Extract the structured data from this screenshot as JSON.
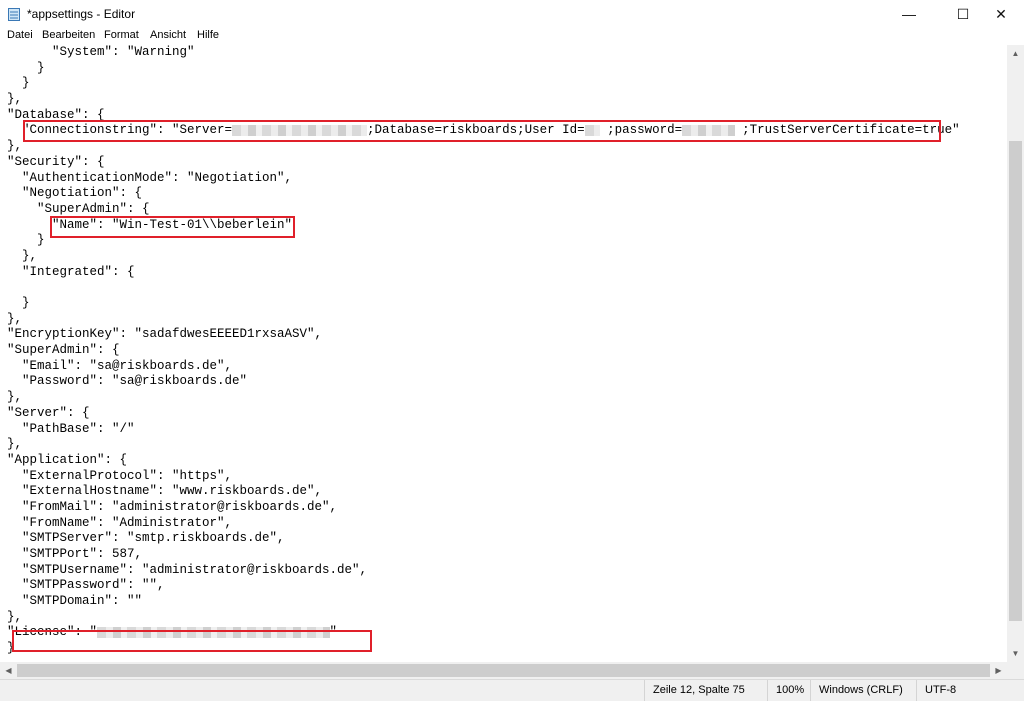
{
  "window": {
    "title": "*appsettings - Editor",
    "buttons": {
      "minimize": "—",
      "maximize": "☐",
      "close": "✕"
    }
  },
  "menu": [
    "Datei",
    "Bearbeiten",
    "Format",
    "Ansicht",
    "Hilfe"
  ],
  "code": [
    {
      "pre": "      \"System\": \"Warning\""
    },
    {
      "pre": "    }"
    },
    {
      "pre": "  }"
    },
    {
      "pre": "},"
    },
    {
      "pre": "\"Database\": {"
    },
    {
      "pre": "  \"Connectionstring\": \"Server=",
      "redacted1": 18,
      "mid": ";Database=riskboards;User Id=",
      "redacted2": 2,
      "mid2": " ;password=",
      "redacted3": 7,
      "post": " ;TrustServerCertificate=true\""
    },
    {
      "pre": "},"
    },
    {
      "pre": "\"Security\": {"
    },
    {
      "pre": "  \"AuthenticationMode\": \"Negotiation\","
    },
    {
      "pre": "  \"Negotiation\": {"
    },
    {
      "pre": "    \"SuperAdmin\": {"
    },
    {
      "pre": "      \"Name\": \"Win-Test-01\\\\beberlein\""
    },
    {
      "pre": "    }"
    },
    {
      "pre": "  },"
    },
    {
      "pre": "  \"Integrated\": {"
    },
    {
      "pre": ""
    },
    {
      "pre": "  }"
    },
    {
      "pre": "},"
    },
    {
      "pre": "\"EncryptionKey\": \"sadafdwesEEEED1rxsaASV\","
    },
    {
      "pre": "\"SuperAdmin\": {"
    },
    {
      "pre": "  \"Email\": \"sa@riskboards.de\","
    },
    {
      "pre": "  \"Password\": \"sa@riskboards.de\""
    },
    {
      "pre": "},"
    },
    {
      "pre": "\"Server\": {"
    },
    {
      "pre": "  \"PathBase\": \"/\""
    },
    {
      "pre": "},"
    },
    {
      "pre": "\"Application\": {"
    },
    {
      "pre": "  \"ExternalProtocol\": \"https\","
    },
    {
      "pre": "  \"ExternalHostname\": \"www.riskboards.de\","
    },
    {
      "pre": "  \"FromMail\": \"administrator@riskboards.de\","
    },
    {
      "pre": "  \"FromName\": \"Administrator\","
    },
    {
      "pre": "  \"SMTPServer\": \"smtp.riskboards.de\","
    },
    {
      "pre": "  \"SMTPPort\": 587,"
    },
    {
      "pre": "  \"SMTPUsername\": \"administrator@riskboards.de\","
    },
    {
      "pre": "  \"SMTPPassword\": \"\","
    },
    {
      "pre": "  \"SMTPDomain\": \"\""
    },
    {
      "pre": "},"
    },
    {
      "pre": "\"License\": \"",
      "redacted1": 31,
      "post": "\""
    },
    {
      "pre": "}"
    }
  ],
  "status": {
    "position": "Zeile 12, Spalte 75",
    "zoom": "100%",
    "line_ending": "Windows (CRLF)",
    "encoding": "UTF-8"
  },
  "colors": {
    "highlight": "#e0202a",
    "chrome": "#f0f0f0"
  }
}
